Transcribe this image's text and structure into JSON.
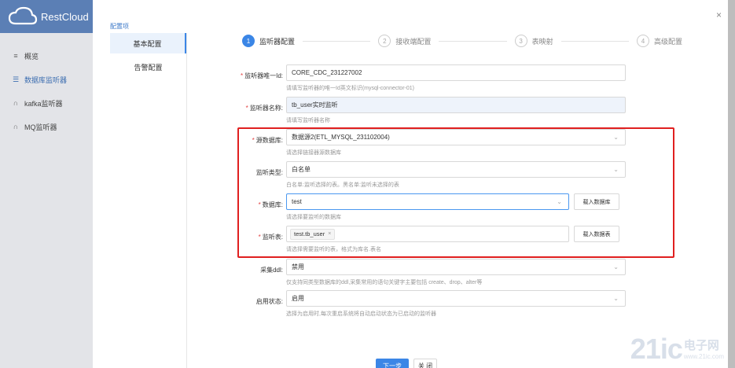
{
  "app": {
    "brand": "RestCloud",
    "nav": [
      {
        "icon": "chart-icon",
        "glyph": "≡",
        "label": "概览"
      },
      {
        "icon": "database-icon",
        "glyph": "☰",
        "label": "数据库监听器"
      },
      {
        "icon": "headset-icon",
        "glyph": "∩",
        "label": "kafka监听器"
      },
      {
        "icon": "headset-icon",
        "glyph": "∩",
        "label": "MQ监听器"
      }
    ]
  },
  "modal": {
    "close": "×",
    "config_title": "配置项",
    "menu": [
      "基本配置",
      "告警配置"
    ],
    "steps": [
      {
        "num": "1",
        "label": "监听器配置"
      },
      {
        "num": "2",
        "label": "接收端配置"
      },
      {
        "num": "3",
        "label": "表映射"
      },
      {
        "num": "4",
        "label": "高级配置"
      }
    ],
    "form": {
      "listener_id": {
        "label": "监听器唯一Id:",
        "value": "CORE_CDC_231227002",
        "hint": "请填写监听器的唯一Id英文标识(mysql-connector-01)"
      },
      "listener_name": {
        "label": "监听器名称:",
        "value": "tb_user实时监听",
        "hint": "请填写监听器名称"
      },
      "source_db": {
        "label": "源数据库:",
        "value": "数据源2(ETL_MYSQL_231102004)",
        "hint": "请选择链接器源数据库"
      },
      "listen_type": {
        "label": "监听类型:",
        "value": "白名单",
        "hint": "白名单:监听选择的表。黑名单:监听未选择的表"
      },
      "database": {
        "label": "数据库:",
        "value": "test",
        "hint": "请选择要监听的数据库",
        "button": "载入数据库"
      },
      "table": {
        "label": "监听表:",
        "tag": "test.tb_user",
        "tag_close": "×",
        "hint": "请选择需要监听的表，格式为库名.表名",
        "button": "载入数据表"
      },
      "collect_ddl": {
        "label": "采集ddl:",
        "value": "禁用",
        "hint": "仅支持同类型数据库的ddl,采集常用的语句关键字主要包括 create、drop、alter等"
      },
      "enable_status": {
        "label": "启用状态:",
        "value": "启用",
        "hint": "选择为启用时,每次重启系统将自动启动状态为已启动的监听器"
      }
    },
    "footer": {
      "next": "下一步",
      "cancel": "关 闭"
    }
  },
  "watermark": {
    "big": "21ic",
    "cn": "电子网",
    "url": "www.21ic.com"
  },
  "colors": {
    "accent": "#3b86e6",
    "highlight_box": "#e02020",
    "sidebar_header": "#5b7fb5"
  }
}
